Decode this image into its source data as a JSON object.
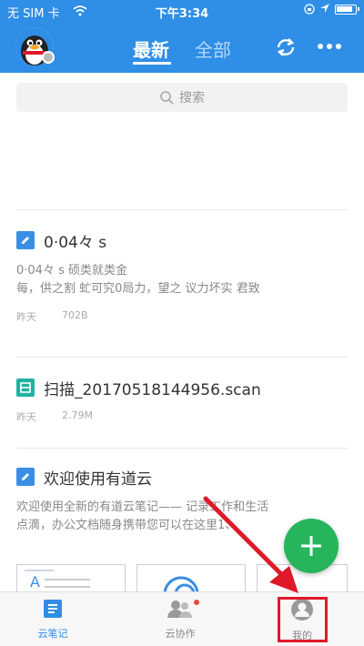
{
  "status_bar": {
    "carrier": "无 SIM 卡",
    "time": "下午3:34"
  },
  "header": {
    "tabs": [
      {
        "label": "最新",
        "active": true
      },
      {
        "label": "全部",
        "active": false
      }
    ],
    "icons": [
      "avatar",
      "sync-icon",
      "more-icon"
    ]
  },
  "search": {
    "placeholder": "搜索"
  },
  "notes": [
    {
      "title": "0·04々 s",
      "icon": "note-icon",
      "body_line1": "0·04々 s 硕类就类金",
      "body_line2": "每，供之割 虻可究0局力，望之 议力坏实 君致",
      "date": "昨天",
      "size": "702B"
    },
    {
      "title": "扫描_20170518144956.scan",
      "icon": "scan-icon",
      "date": "昨天",
      "size": "2.79M"
    },
    {
      "title": "欢迎使用有道云",
      "icon": "note-icon",
      "body_line1": "欢迎使用全新的有道云笔记—— 记录工作和生活",
      "body_line2": "点滴，办公文档随身携带您可以在这里1、"
    }
  ],
  "bottom_nav": [
    {
      "label": "云笔记",
      "active": true
    },
    {
      "label": "云协作",
      "active": false,
      "badge": true
    },
    {
      "label": "我的",
      "active": false,
      "highlighted": true
    }
  ],
  "colors": {
    "header_bg": "#2f8ee6",
    "fab_bg": "#26b55a",
    "highlight": "#e0192a"
  }
}
